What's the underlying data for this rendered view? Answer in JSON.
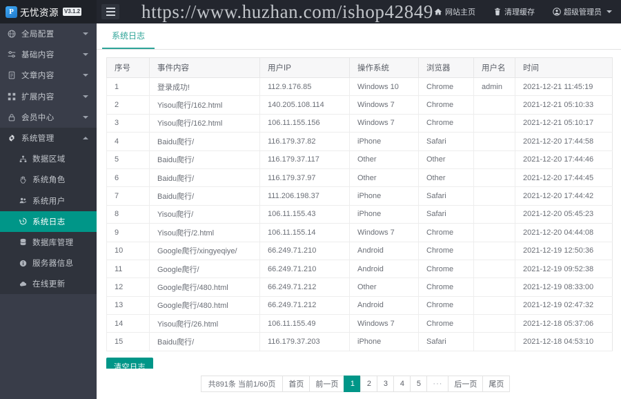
{
  "brand": {
    "logo_letter": "P",
    "name": "无忧资源",
    "version": "V3.1.2"
  },
  "watermark": "https://www.huzhan.com/ishop42849",
  "topnav": [
    {
      "label": "网站主页",
      "icon": "home-icon"
    },
    {
      "label": "清理缓存",
      "icon": "trash-icon"
    },
    {
      "label": "超级管理员",
      "icon": "user-circle-icon"
    }
  ],
  "sidebar": {
    "items": [
      {
        "label": "全局配置",
        "icon": "globe-icon",
        "open": false
      },
      {
        "label": "基础内容",
        "icon": "sliders-icon",
        "open": false
      },
      {
        "label": "文章内容",
        "icon": "document-icon",
        "open": false
      },
      {
        "label": "扩展内容",
        "icon": "expand-icon",
        "open": false
      },
      {
        "label": "会员中心",
        "icon": "lock-icon",
        "open": false
      },
      {
        "label": "系统管理",
        "icon": "gear-icon",
        "open": true
      }
    ],
    "submenu": [
      {
        "label": "数据区域",
        "icon": "sitemap-icon",
        "active": false
      },
      {
        "label": "系统角色",
        "icon": "hand-icon",
        "active": false
      },
      {
        "label": "系统用户",
        "icon": "users-icon",
        "active": false
      },
      {
        "label": "系统日志",
        "icon": "history-icon",
        "active": true
      },
      {
        "label": "数据库管理",
        "icon": "database-icon",
        "active": false
      },
      {
        "label": "服务器信息",
        "icon": "info-icon",
        "active": false
      },
      {
        "label": "在线更新",
        "icon": "cloud-icon",
        "active": false
      }
    ]
  },
  "tab": {
    "label": "系统日志"
  },
  "table": {
    "headers": [
      "序号",
      "事件内容",
      "用户IP",
      "操作系统",
      "浏览器",
      "用户名",
      "时间"
    ],
    "rows": [
      [
        "1",
        "登录成功!",
        "112.9.176.85",
        "Windows 10",
        "Chrome",
        "admin",
        "2021-12-21 11:45:19"
      ],
      [
        "2",
        "Yisou爬行/162.html",
        "140.205.108.114",
        "Windows 7",
        "Chrome",
        "",
        "2021-12-21 05:10:33"
      ],
      [
        "3",
        "Yisou爬行/162.html",
        "106.11.155.156",
        "Windows 7",
        "Chrome",
        "",
        "2021-12-21 05:10:17"
      ],
      [
        "4",
        "Baidu爬行/",
        "116.179.37.82",
        "iPhone",
        "Safari",
        "",
        "2021-12-20 17:44:58"
      ],
      [
        "5",
        "Baidu爬行/",
        "116.179.37.117",
        "Other",
        "Other",
        "",
        "2021-12-20 17:44:46"
      ],
      [
        "6",
        "Baidu爬行/",
        "116.179.37.97",
        "Other",
        "Other",
        "",
        "2021-12-20 17:44:45"
      ],
      [
        "7",
        "Baidu爬行/",
        "111.206.198.37",
        "iPhone",
        "Safari",
        "",
        "2021-12-20 17:44:42"
      ],
      [
        "8",
        "Yisou爬行/",
        "106.11.155.43",
        "iPhone",
        "Safari",
        "",
        "2021-12-20 05:45:23"
      ],
      [
        "9",
        "Yisou爬行/2.html",
        "106.11.155.14",
        "Windows 7",
        "Chrome",
        "",
        "2021-12-20 04:44:08"
      ],
      [
        "10",
        "Google爬行/xingyeqiye/",
        "66.249.71.210",
        "Android",
        "Chrome",
        "",
        "2021-12-19 12:50:36"
      ],
      [
        "11",
        "Google爬行/",
        "66.249.71.210",
        "Android",
        "Chrome",
        "",
        "2021-12-19 09:52:38"
      ],
      [
        "12",
        "Google爬行/480.html",
        "66.249.71.212",
        "Other",
        "Chrome",
        "",
        "2021-12-19 08:33:00"
      ],
      [
        "13",
        "Google爬行/480.html",
        "66.249.71.212",
        "Android",
        "Chrome",
        "",
        "2021-12-19 02:47:32"
      ],
      [
        "14",
        "Yisou爬行/26.html",
        "106.11.155.49",
        "Windows 7",
        "Chrome",
        "",
        "2021-12-18 05:37:06"
      ],
      [
        "15",
        "Baidu爬行/",
        "116.179.37.203",
        "iPhone",
        "Safari",
        "",
        "2021-12-18 04:53:10"
      ]
    ]
  },
  "actions": {
    "clear_log_label": "清空日志"
  },
  "pagination": {
    "info": "共891条 当前1/60页",
    "first_label": "首页",
    "prev_label": "前一页",
    "pages": [
      "1",
      "2",
      "3",
      "4",
      "5"
    ],
    "dots": "···",
    "next_label": "后一页",
    "last_label": "尾页",
    "current": "1"
  },
  "colors": {
    "accent": "#009688",
    "sidebar_bg": "#393D49",
    "topbar_bg": "#23262E",
    "tab_text": "#2da397"
  }
}
